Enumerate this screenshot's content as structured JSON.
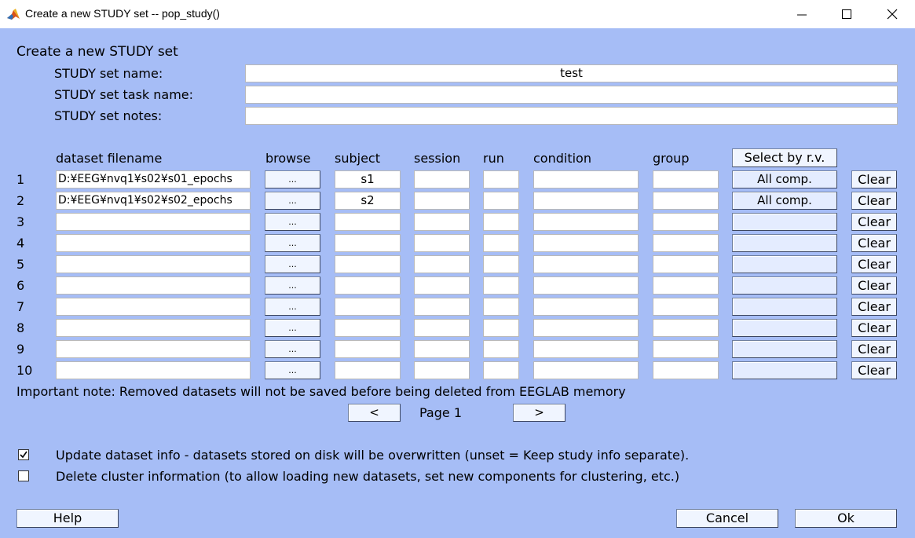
{
  "window": {
    "title": "Create a new STUDY set -- pop_study()",
    "minimize_glyph": "—",
    "maximize_glyph": "☐",
    "close_glyph": "✕"
  },
  "form": {
    "heading": "Create a new STUDY set",
    "name_label": "STUDY set name:",
    "name_value": "test",
    "task_label": "STUDY set task name:",
    "task_value": "",
    "notes_label": "STUDY set notes:",
    "notes_value": ""
  },
  "table": {
    "headers": {
      "filename": "dataset filename",
      "browse": "browse",
      "subject": "subject",
      "session": "session",
      "run": "run",
      "condition": "condition",
      "group": "group"
    },
    "select_button": "Select by r.v.",
    "browse_label": "...",
    "clear_label": "Clear",
    "rows": [
      {
        "num": "1",
        "filename": "D:¥EEG¥nvq1¥s02¥s01_epochs",
        "subject": "s1",
        "session": "",
        "run": "",
        "condition": "",
        "group": "",
        "comp": "All comp."
      },
      {
        "num": "2",
        "filename": "D:¥EEG¥nvq1¥s02¥s02_epochs",
        "subject": "s2",
        "session": "",
        "run": "",
        "condition": "",
        "group": "",
        "comp": "All comp."
      },
      {
        "num": "3",
        "filename": "",
        "subject": "",
        "session": "",
        "run": "",
        "condition": "",
        "group": "",
        "comp": ""
      },
      {
        "num": "4",
        "filename": "",
        "subject": "",
        "session": "",
        "run": "",
        "condition": "",
        "group": "",
        "comp": ""
      },
      {
        "num": "5",
        "filename": "",
        "subject": "",
        "session": "",
        "run": "",
        "condition": "",
        "group": "",
        "comp": ""
      },
      {
        "num": "6",
        "filename": "",
        "subject": "",
        "session": "",
        "run": "",
        "condition": "",
        "group": "",
        "comp": ""
      },
      {
        "num": "7",
        "filename": "",
        "subject": "",
        "session": "",
        "run": "",
        "condition": "",
        "group": "",
        "comp": ""
      },
      {
        "num": "8",
        "filename": "",
        "subject": "",
        "session": "",
        "run": "",
        "condition": "",
        "group": "",
        "comp": ""
      },
      {
        "num": "9",
        "filename": "",
        "subject": "",
        "session": "",
        "run": "",
        "condition": "",
        "group": "",
        "comp": ""
      },
      {
        "num": "10",
        "filename": "",
        "subject": "",
        "session": "",
        "run": "",
        "condition": "",
        "group": "",
        "comp": ""
      }
    ]
  },
  "note": "Important note: Removed datasets will not be saved before being deleted from EEGLAB memory",
  "pager": {
    "prev": "<",
    "label": "Page 1",
    "next": ">"
  },
  "options": {
    "update_label": "Update dataset info - datasets stored on disk will be overwritten (unset = Keep study info separate).",
    "update_checked": true,
    "delete_label": "Delete cluster information (to allow loading new datasets, set new components for clustering, etc.)",
    "delete_checked": false
  },
  "buttons": {
    "help": "Help",
    "cancel": "Cancel",
    "ok": "Ok"
  },
  "colors": {
    "background": "#a6bdf6",
    "button_face": "#f0f5ff",
    "field": "#ffffff"
  }
}
